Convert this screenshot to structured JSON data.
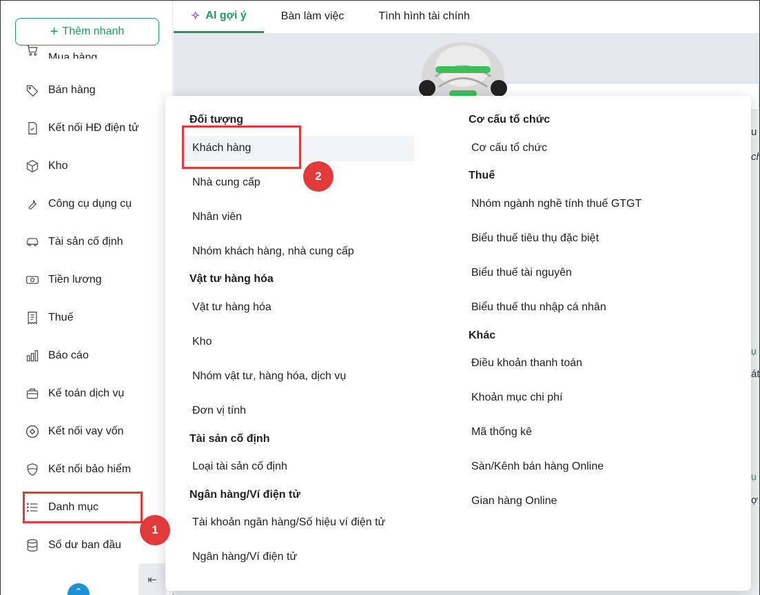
{
  "sidebar": {
    "quick_add": "Thêm nhanh",
    "items": [
      {
        "label": "Mua hàng",
        "icon": "cart-icon"
      },
      {
        "label": "Bán hàng",
        "icon": "tag-icon"
      },
      {
        "label": "Kết nối HĐ điện tử",
        "icon": "invoice-check-icon"
      },
      {
        "label": "Kho",
        "icon": "box-icon"
      },
      {
        "label": "Công cụ dụng cụ",
        "icon": "wrench-icon"
      },
      {
        "label": "Tài sản cố định",
        "icon": "car-icon"
      },
      {
        "label": "Tiền lương",
        "icon": "money-icon"
      },
      {
        "label": "Thuế",
        "icon": "receipt-icon"
      },
      {
        "label": "Báo cáo",
        "icon": "bar-chart-icon"
      },
      {
        "label": "Kế toán dịch vụ",
        "icon": "briefcase-icon"
      },
      {
        "label": "Kết nối vay vốn",
        "icon": "loan-link-icon"
      },
      {
        "label": "Kết nối bảo hiểm",
        "icon": "shield-icon"
      },
      {
        "label": "Danh mục",
        "icon": "list-icon"
      },
      {
        "label": "Số dư ban đầu",
        "icon": "database-icon"
      }
    ]
  },
  "tabs": [
    {
      "label": "AI gợi ý",
      "active": true
    },
    {
      "label": "Bàn làm việc",
      "active": false
    },
    {
      "label": "Tình hình tài chính",
      "active": false
    }
  ],
  "menu": {
    "left": [
      {
        "title": "Đối tượng",
        "links": [
          "Khách hàng",
          "Nhà cung cấp",
          "Nhân viên",
          "Nhóm khách hàng, nhà cung cấp"
        ]
      },
      {
        "title": "Vật tư hàng hóa",
        "links": [
          "Vật tư hàng hóa",
          "Kho",
          "Nhóm vật tư, hàng hóa, dịch vụ",
          "Đơn vị tính"
        ]
      },
      {
        "title": "Tài sản cố định",
        "links": [
          "Loại tài sản cố định"
        ]
      },
      {
        "title": "Ngân hàng/Ví điện tử",
        "links": [
          "Tài khoản ngân hàng/Số hiệu ví điện tử",
          "Ngân hàng/Ví điện tử"
        ]
      }
    ],
    "right": [
      {
        "title": "Cơ cấu tổ chức",
        "links": [
          "Cơ cấu tổ chức"
        ]
      },
      {
        "title": "Thuế",
        "links": [
          "Nhóm ngành nghề tính thuế GTGT",
          "Biểu thuế tiêu thụ đặc biệt",
          "Biểu thuế tài nguyên",
          "Biểu thuế thu nhập cá nhân"
        ]
      },
      {
        "title": "Khác",
        "links": [
          "Điều khoản thanh toán",
          "Khoản mục chi phí",
          "Mã thống kê",
          "Sàn/Kênh bán hàng Online",
          "Gian hàng Online"
        ]
      }
    ]
  },
  "annotations": {
    "step1": "1",
    "step2": "2"
  },
  "colors": {
    "accent": "#1a9b61",
    "annotation": "#e2393b"
  }
}
